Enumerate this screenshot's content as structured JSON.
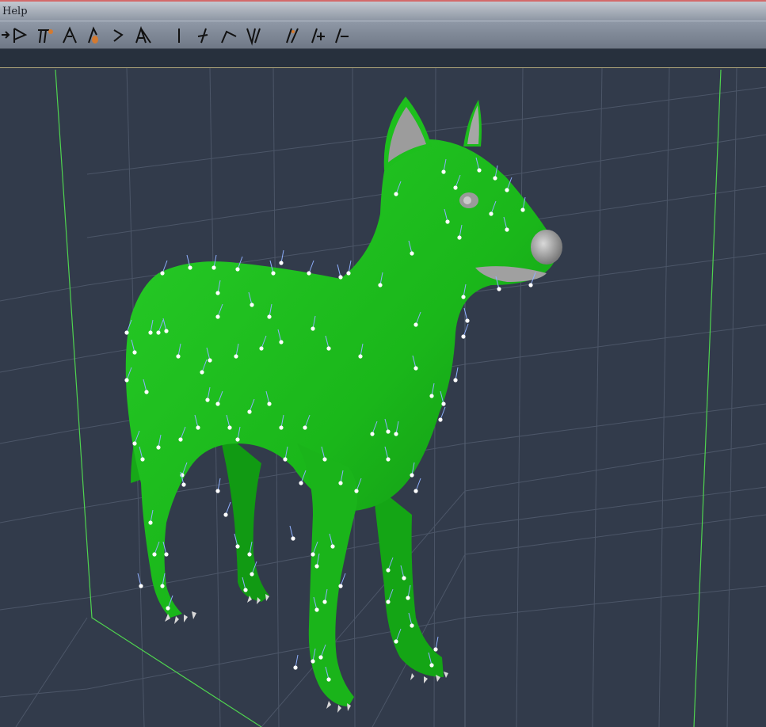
{
  "menu": {
    "help_label": "Help"
  },
  "toolbar": {
    "tools": [
      {
        "name": "chain-break-tool-icon"
      },
      {
        "name": "rotate-tool-icon"
      },
      {
        "name": "twist-tool-icon"
      },
      {
        "name": "translate-tool-icon"
      },
      {
        "name": "translate-in-out-tool-icon"
      },
      {
        "name": "scale-tool-icon"
      },
      {
        "name": "taper-tool-icon"
      },
      {
        "name": "color-tool-icon"
      },
      {
        "name": "grouping-tool-icon"
      },
      {
        "name": "view-magnifier-tool-icon"
      },
      {
        "name": "morphing-tool-icon"
      },
      {
        "name": "direct-manipulation-tool-icon"
      },
      {
        "name": "hair-groom-tool-icon"
      },
      {
        "name": "add-guide-hair-tool-icon"
      },
      {
        "name": "remove-guide-hair-tool-icon"
      }
    ]
  },
  "viewport": {
    "subject": "dog-figure",
    "figure_color": "#1dbf1d",
    "background_color": "#323b4b",
    "grid_color": "#4c5668",
    "bounding_box_color": "#4fd34f"
  }
}
